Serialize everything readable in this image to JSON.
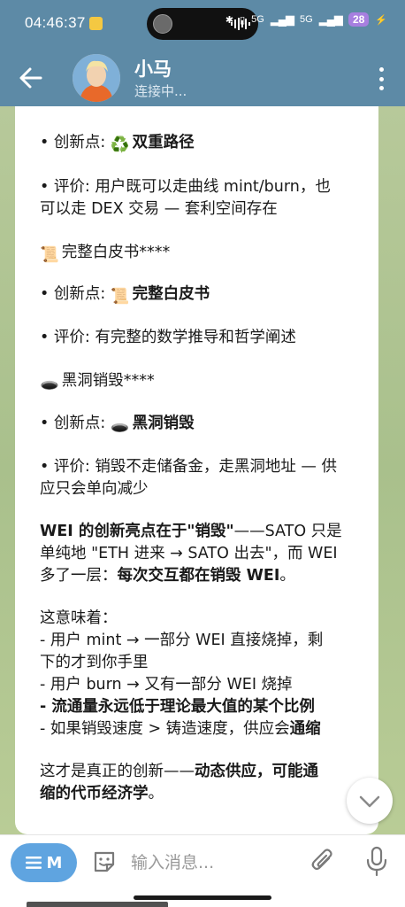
{
  "status_bar": {
    "time": "04:46:37",
    "battery": "28",
    "network_1": "5G",
    "network_2": "5G"
  },
  "header": {
    "title": "小马",
    "status": "连接中..."
  },
  "message": {
    "lines": [
      {
        "prefix": "• 创新点: ",
        "emoji": "♻️",
        "bold": "双重路径",
        "rest": ""
      },
      {
        "prefix": "• 评价: 用户既可以走曲线 mint/burn，也",
        "emoji": "",
        "bold": "",
        "rest": ""
      },
      {
        "prefix": "可以走 DEX 交易 — 套利空间存在",
        "emoji": "",
        "bold": "",
        "rest": ""
      },
      {
        "prefix": "",
        "emoji": "📜",
        "bold": "",
        "rest": "完整白皮书****"
      },
      {
        "prefix": "• 创新点: ",
        "emoji": "📜",
        "bold": "完整白皮书",
        "rest": ""
      },
      {
        "prefix": "• 评价: 有完整的数学推导和哲学阐述",
        "emoji": "",
        "bold": "",
        "rest": ""
      },
      {
        "prefix": "",
        "emoji": "🕳️",
        "bold": "",
        "rest": "黑洞销毁****"
      },
      {
        "prefix": "• 创新点: ",
        "emoji": "🕳️",
        "bold": "黑洞销毁",
        "rest": ""
      },
      {
        "prefix": "• 评价: 销毁不走储备金，走黑洞地址 — 供",
        "emoji": "",
        "bold": "",
        "rest": ""
      },
      {
        "prefix": "应只会单向减少",
        "emoji": "",
        "bold": "",
        "rest": ""
      }
    ],
    "para_wei_1_bold": "WEI 的创新亮点在于\"销毁\"",
    "para_wei_1_rest": "——SATO 只是",
    "para_wei_2": "单纯地 \"ETH 进来 → SATO 出去\"，而 WEI",
    "para_wei_3_prefix": "多了一层：",
    "para_wei_3_bold": "每次交互都在销毁 WEI",
    "para_wei_3_end": "。",
    "meaning_title": "这意味着：",
    "meaning_1": "- 用户 mint → 一部分 WEI 直接烧掉，剩",
    "meaning_1b": "下的才到你手里",
    "meaning_2": "- 用户 burn → 又有一部分 WEI 烧掉",
    "meaning_3": "- 流通量永远低于理论最大值的某个比例",
    "meaning_4_prefix": "- 如果销毁速度 > 铸造速度，供应会",
    "meaning_4_bold": "通缩",
    "conclusion_1_prefix": "这才是真正的创新——",
    "conclusion_1_bold": "动态供应，可能通",
    "conclusion_2_bold": "缩的代币经济学",
    "conclusion_2_end": "。"
  },
  "input": {
    "menu_label": "M",
    "placeholder": "输入消息..."
  },
  "colors": {
    "header": "#5d8aa6",
    "menu_pill": "#5fa4e0",
    "chat_bg": "#b7c99a"
  }
}
